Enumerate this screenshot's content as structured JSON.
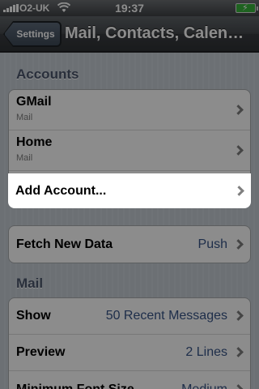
{
  "status_bar": {
    "carrier": "O2-UK",
    "time": "19:37",
    "battery_icon": "charging-battery-icon",
    "wifi_icon": "wifi-icon",
    "signal_icon": "signal-bars-icon"
  },
  "nav": {
    "back_label": "Settings",
    "title": "Mail, Contacts, Calendars"
  },
  "accounts": {
    "header": "Accounts",
    "items": [
      {
        "title": "GMail",
        "subtitle": "Mail"
      },
      {
        "title": "Home",
        "subtitle": "Mail"
      }
    ],
    "add_label": "Add Account..."
  },
  "fetch": {
    "label": "Fetch New Data",
    "value": "Push"
  },
  "mail": {
    "header": "Mail",
    "rows": [
      {
        "label": "Show",
        "value": "50 Recent Messages"
      },
      {
        "label": "Preview",
        "value": "2 Lines"
      },
      {
        "label": "Minimum Font Size",
        "value": "Medium"
      }
    ]
  },
  "colors": {
    "accent_value": "#385487",
    "section_header": "#4c566c"
  }
}
